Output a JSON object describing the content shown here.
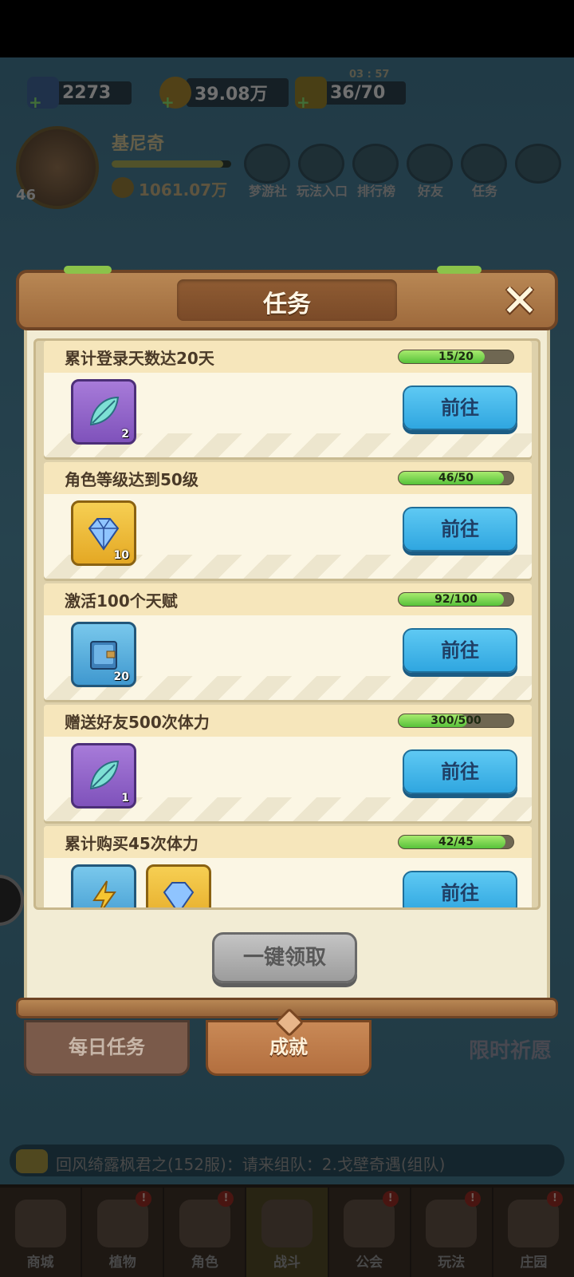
{
  "resources": {
    "diamonds": "2273",
    "gold": "39.08万",
    "energy": "36/70",
    "energy_timer": "03 : 57"
  },
  "player": {
    "name": "基尼奇",
    "level": "46",
    "power": "1061.07万",
    "exp_fraction": 0.93
  },
  "top_menu": [
    "梦游社",
    "玩法入口",
    "排行榜",
    "好友",
    "任务"
  ],
  "dialog": {
    "title": "任务",
    "close_symbol": "✕",
    "claim_all_label": "一键领取",
    "tabs": {
      "daily": "每日任务",
      "achievements": "成就"
    },
    "tasks": [
      {
        "name": "累计登录天数达20天",
        "progress": "15/20",
        "fraction": 0.75,
        "go_label": "前往",
        "rewards": [
          {
            "type": "leaf",
            "color": "purple",
            "count": "2"
          }
        ]
      },
      {
        "name": "角色等级达到50级",
        "progress": "46/50",
        "fraction": 0.92,
        "go_label": "前往",
        "rewards": [
          {
            "type": "diamond",
            "color": "gold",
            "count": "10"
          }
        ]
      },
      {
        "name": "激活100个天赋",
        "progress": "92/100",
        "fraction": 0.92,
        "go_label": "前往",
        "rewards": [
          {
            "type": "book",
            "color": "blue",
            "count": "20"
          }
        ]
      },
      {
        "name": "赠送好友500次体力",
        "progress": "300/500",
        "fraction": 0.6,
        "go_label": "前往",
        "rewards": [
          {
            "type": "leaf",
            "color": "purple",
            "count": "1"
          }
        ]
      },
      {
        "name": "累计购买45次体力",
        "progress": "42/45",
        "fraction": 0.93,
        "go_label": "前往",
        "rewards": [
          {
            "type": "energy",
            "color": "blue",
            "count": ""
          },
          {
            "type": "diamond",
            "color": "gold",
            "count": ""
          }
        ]
      }
    ]
  },
  "chat": {
    "message": "回风绮露枫君之(152服)：请来组队：2.戈壁奇遇(组队)"
  },
  "side": {
    "wish_label": "限时祈愿"
  },
  "bottom_nav": [
    {
      "label": "商城",
      "badge": ""
    },
    {
      "label": "植物",
      "badge": "!"
    },
    {
      "label": "角色",
      "badge": "!"
    },
    {
      "label": "战斗",
      "badge": "",
      "active": true
    },
    {
      "label": "公会",
      "badge": "!"
    },
    {
      "label": "玩法",
      "badge": "!"
    },
    {
      "label": "庄园",
      "badge": "!"
    }
  ],
  "colors": {
    "button_blue": "#2fa6e0",
    "progress_green": "#57c23a",
    "panel_brown": "#9e6a3c"
  }
}
